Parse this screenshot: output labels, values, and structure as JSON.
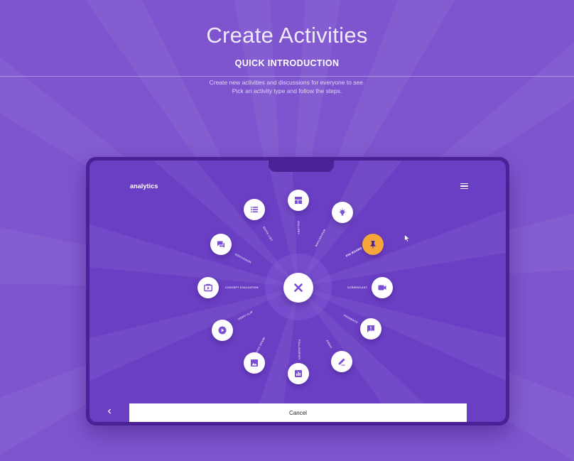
{
  "hero": {
    "title": "Create Activities",
    "subtitle": "QUICK INTRODUCTION",
    "desc_line1": "Create new activities and discussions for everyone to see.",
    "desc_line2": "Pick an activity type and follow the steps."
  },
  "app": {
    "logo": "analytics",
    "menu_icon": "hamburger-menu-icon",
    "close_icon": "close-x-icon"
  },
  "options": [
    {
      "key": "gallery",
      "label": "GALLERY",
      "icon": "dashboard-layout-icon"
    },
    {
      "key": "brainstorm",
      "label": "BRAINSTORM",
      "icon": "lightbulb-icon"
    },
    {
      "key": "pin-board",
      "label": "PIN BOARD",
      "icon": "pin-icon",
      "active": true
    },
    {
      "key": "screencast",
      "label": "SCREENCAST",
      "icon": "videocam-icon"
    },
    {
      "key": "feedback",
      "label": "FEEDBACK",
      "icon": "feedback-message-icon"
    },
    {
      "key": "essay",
      "label": "ESSAY",
      "icon": "pencil-icon"
    },
    {
      "key": "poll",
      "label": "POLL/SURVEY",
      "icon": "bar-chart-icon"
    },
    {
      "key": "image",
      "label": "IMAGE VOTING",
      "icon": "image-icon"
    },
    {
      "key": "video-clip",
      "label": "VIDEO CLIP",
      "icon": "play-circle-icon"
    },
    {
      "key": "concept-evaluation",
      "label": "CONCEPT EVALUATION",
      "icon": "slideshow-icon"
    },
    {
      "key": "discussion",
      "label": "DISCUSSION",
      "icon": "chat-bubble-icon"
    },
    {
      "key": "quick-list",
      "label": "QUICK LIST",
      "icon": "list-icon"
    }
  ],
  "footer": {
    "back_icon": "chevron-left-icon",
    "cancel_label": "Cancel"
  },
  "colors": {
    "background": "#7e55cf",
    "device_frame": "#4a2296",
    "screen": "#6b3fc4",
    "accent": "#f6a53b",
    "icon_purple": "#7a4fd1"
  }
}
